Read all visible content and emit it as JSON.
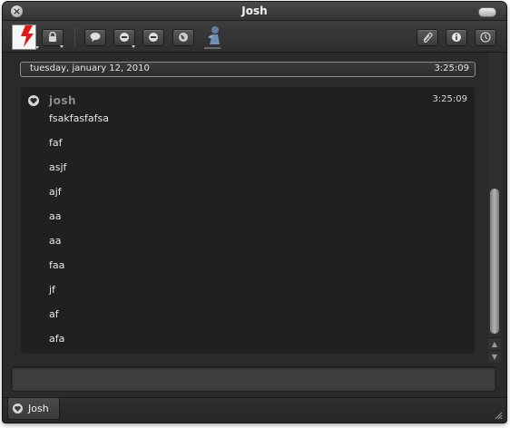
{
  "window": {
    "title": "Josh"
  },
  "toolbar": {
    "left_buttons": [
      "lock-icon",
      "speech-bubble-icon",
      "block-icon",
      "minus-circle-icon",
      "globe-icon",
      "person-icon"
    ],
    "right_buttons": [
      "paperclip-icon",
      "info-icon",
      "clock-icon"
    ]
  },
  "chat": {
    "date_header": "tuesday, january 12, 2010",
    "date_header_time": "3:25:09",
    "message": {
      "sender": "josh",
      "time": "3:25:09",
      "lines": [
        "fsakfasfafsa",
        "faf",
        "asjf",
        "ajf",
        "aa",
        "aa",
        "faa",
        "jf",
        "af",
        "afa"
      ]
    }
  },
  "input": {
    "value": ""
  },
  "tabs": [
    {
      "label": "Josh"
    }
  ],
  "colors": {
    "window_bg": "#2b2b2b",
    "panel_bg": "#202020",
    "text": "#e8e8e8",
    "sender": "#8c8c8c"
  }
}
